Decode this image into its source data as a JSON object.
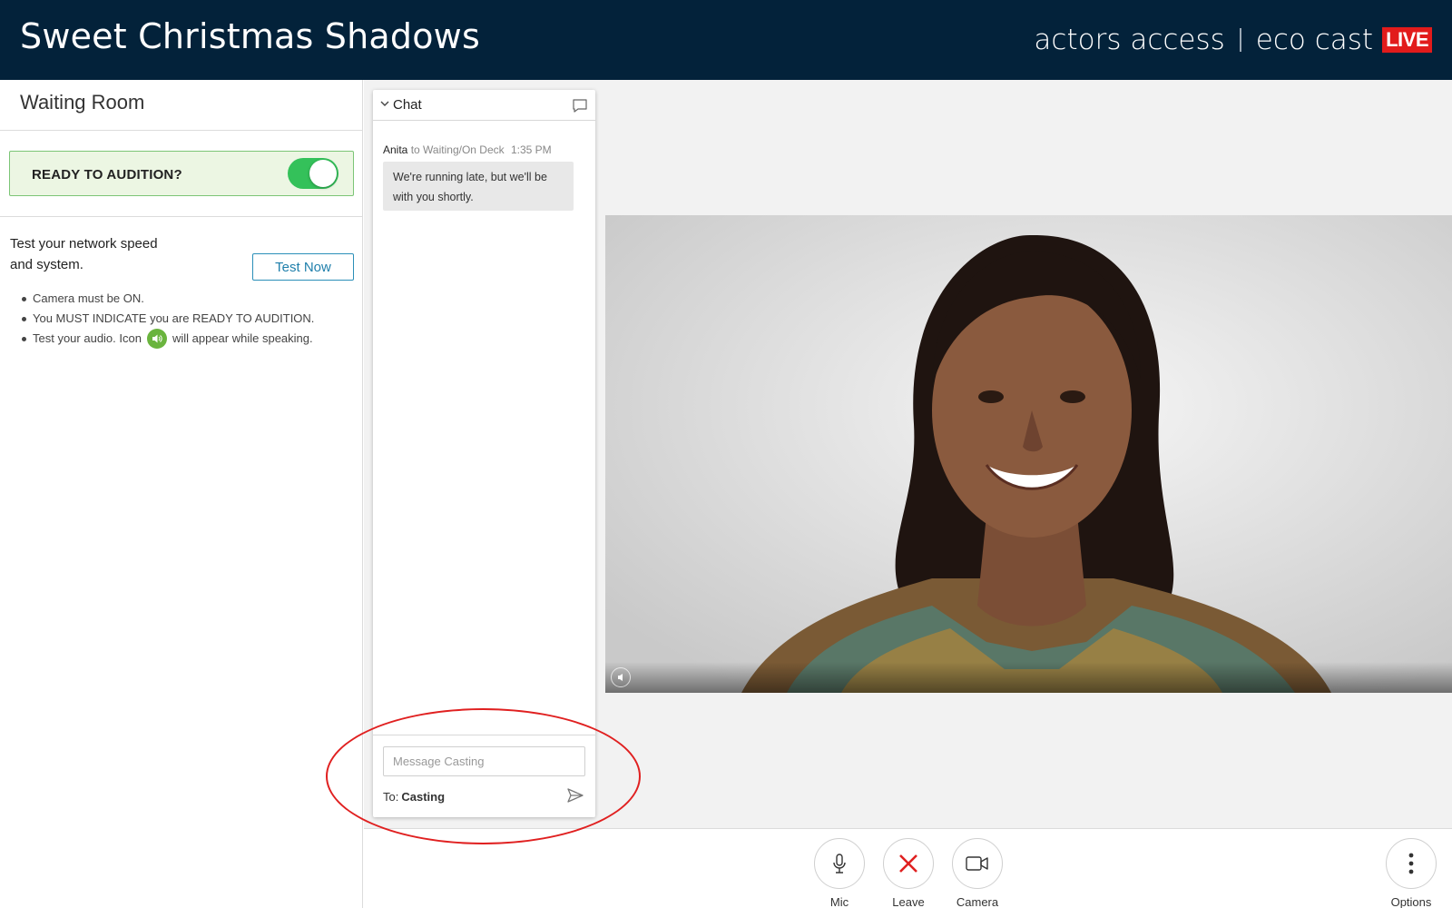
{
  "header": {
    "project_title": "Sweet Christmas Shadows",
    "brand_left": "actors access",
    "brand_right": "eco cast",
    "live_badge": "LIVE"
  },
  "left_panel": {
    "title": "Waiting Room",
    "ready_label": "READY TO AUDITION?",
    "ready_toggle_on": true,
    "network_text_line1": "Test your network speed",
    "network_text_line2": "and system.",
    "test_button_label": "Test Now",
    "rules": {
      "r1": "Camera must be ON.",
      "r2": "You MUST INDICATE you are READY TO AUDITION.",
      "r3_before": "Test your audio. Icon",
      "r3_after": "will appear while speaking."
    }
  },
  "chat": {
    "title": "Chat",
    "message": {
      "sender": "Anita",
      "to": "to Waiting/On Deck",
      "time": "1:35 PM",
      "text": "We're running late, but we'll be with you shortly."
    },
    "input_placeholder": "Message Casting",
    "to_label": "To:",
    "recipient": "Casting"
  },
  "controls": {
    "mic_label": "Mic",
    "leave_label": "Leave",
    "camera_label": "Camera",
    "options_label": "Options"
  },
  "colors": {
    "header_bg": "#03223a",
    "live_red": "#e21b1b",
    "toggle_green": "#34c15a",
    "ready_bg": "#ecf6e3",
    "accent_blue": "#1f7fab",
    "leave_red": "#e02020"
  },
  "icons": {
    "chevron": "chevron-down-icon",
    "chat": "chat-bubble-icon",
    "send": "send-icon",
    "mic": "microphone-icon",
    "leave": "close-icon",
    "camera": "video-camera-icon",
    "options": "more-vertical-icon",
    "speaker": "speaker-icon"
  }
}
